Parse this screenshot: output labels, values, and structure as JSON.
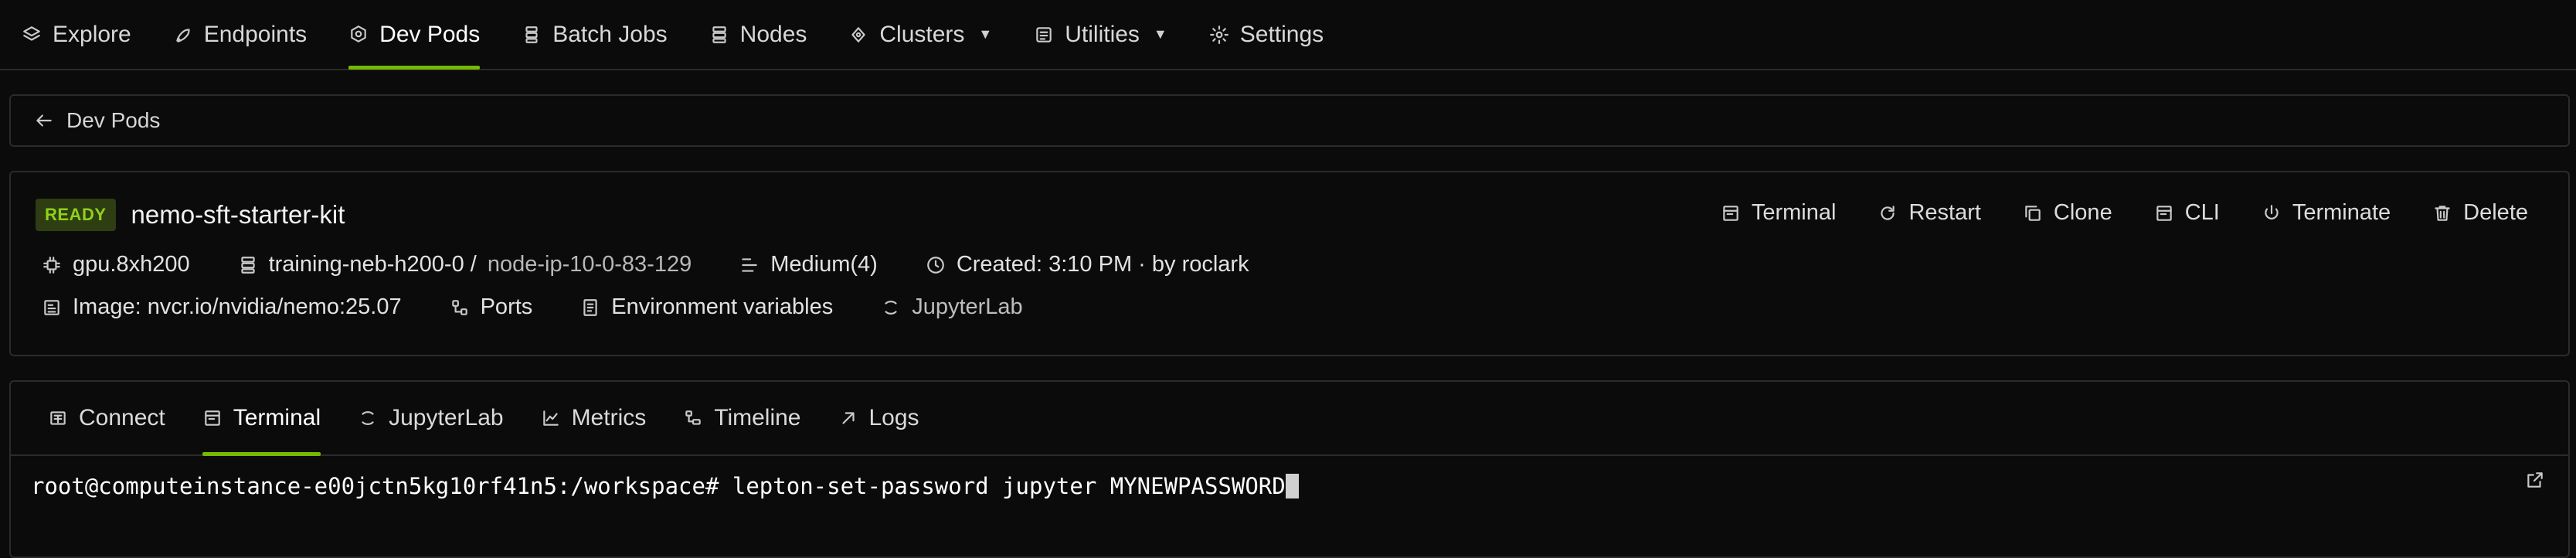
{
  "nav": {
    "items": [
      {
        "label": "Explore",
        "icon": "layers-icon"
      },
      {
        "label": "Endpoints",
        "icon": "rocket-icon"
      },
      {
        "label": "Dev Pods",
        "icon": "pod-icon",
        "active": true
      },
      {
        "label": "Batch Jobs",
        "icon": "batch-icon"
      },
      {
        "label": "Nodes",
        "icon": "server-icon"
      },
      {
        "label": "Clusters",
        "icon": "cluster-icon",
        "dropdown": true
      },
      {
        "label": "Utilities",
        "icon": "utilities-icon",
        "dropdown": true
      },
      {
        "label": "Settings",
        "icon": "gear-icon"
      }
    ]
  },
  "back": {
    "label": "Dev Pods"
  },
  "pod": {
    "status": "READY",
    "name": "nemo-sft-starter-kit",
    "resource": "gpu.8xh200",
    "workspace": "training-neb-h200-0 /",
    "node": " node-ip-10-0-83-129",
    "priority": "Medium(4)",
    "created": "Created: 3:10 PM · by roclark",
    "image": "Image: nvcr.io/nvidia/nemo:25.07",
    "ports": "Ports",
    "env": "Environment variables",
    "jupyter": "JupyterLab"
  },
  "actions": {
    "terminal": "Terminal",
    "restart": "Restart",
    "clone": "Clone",
    "cli": "CLI",
    "terminate": "Terminate",
    "delete": "Delete"
  },
  "tabs": {
    "connect": "Connect",
    "terminal": "Terminal",
    "jupyterlab": "JupyterLab",
    "metrics": "Metrics",
    "timeline": "Timeline",
    "logs": "Logs"
  },
  "terminal": {
    "line": "root@computeinstance-e00jctn5kg10rf41n5:/workspace# lepton-set-password jupyter MYNEWPASSWORD"
  },
  "colors": {
    "accent": "#76b900",
    "badge_bg": "#2e3d12",
    "badge_text": "#8fd11a",
    "background": "#0b0b0b"
  }
}
